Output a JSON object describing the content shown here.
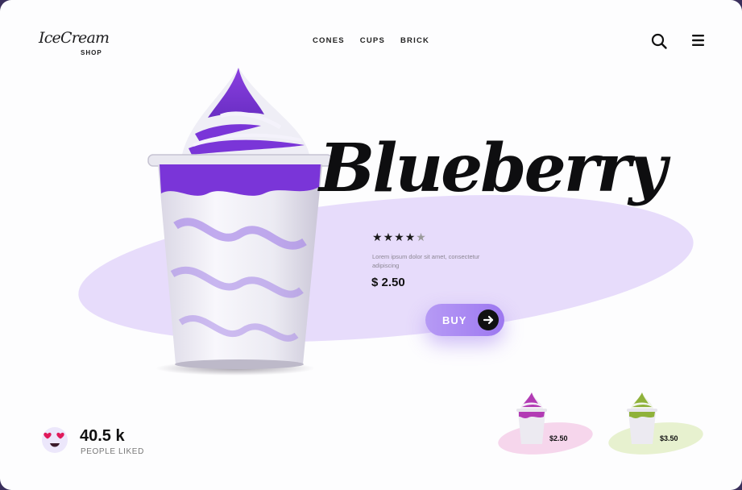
{
  "brand": {
    "script": "IceCream",
    "sub": "SHOP"
  },
  "nav": {
    "items": [
      "CONES",
      "CUPS",
      "BRICK"
    ]
  },
  "header_icons": {
    "search": "search-icon",
    "menu": "hamburger-menu-icon"
  },
  "hero": {
    "title": "Blueberry",
    "rating": 4,
    "rating_max": 5,
    "description": "Lorem ipsum dolor sit amet, consectetur adipiscing",
    "price": "$ 2.50",
    "buy_label": "BUY",
    "accent": "#9d78f0"
  },
  "likes": {
    "count": "40.5 k",
    "label": "PEOPLE LIKED",
    "icon": "heart-eyes-emoji-icon"
  },
  "products": [
    {
      "flavor_color": "#b23bb4",
      "price": "$2.50",
      "bg": "#f6d6ec"
    },
    {
      "flavor_color": "#8fb23a",
      "price": "$3.50",
      "bg": "#e7f1cf"
    }
  ]
}
